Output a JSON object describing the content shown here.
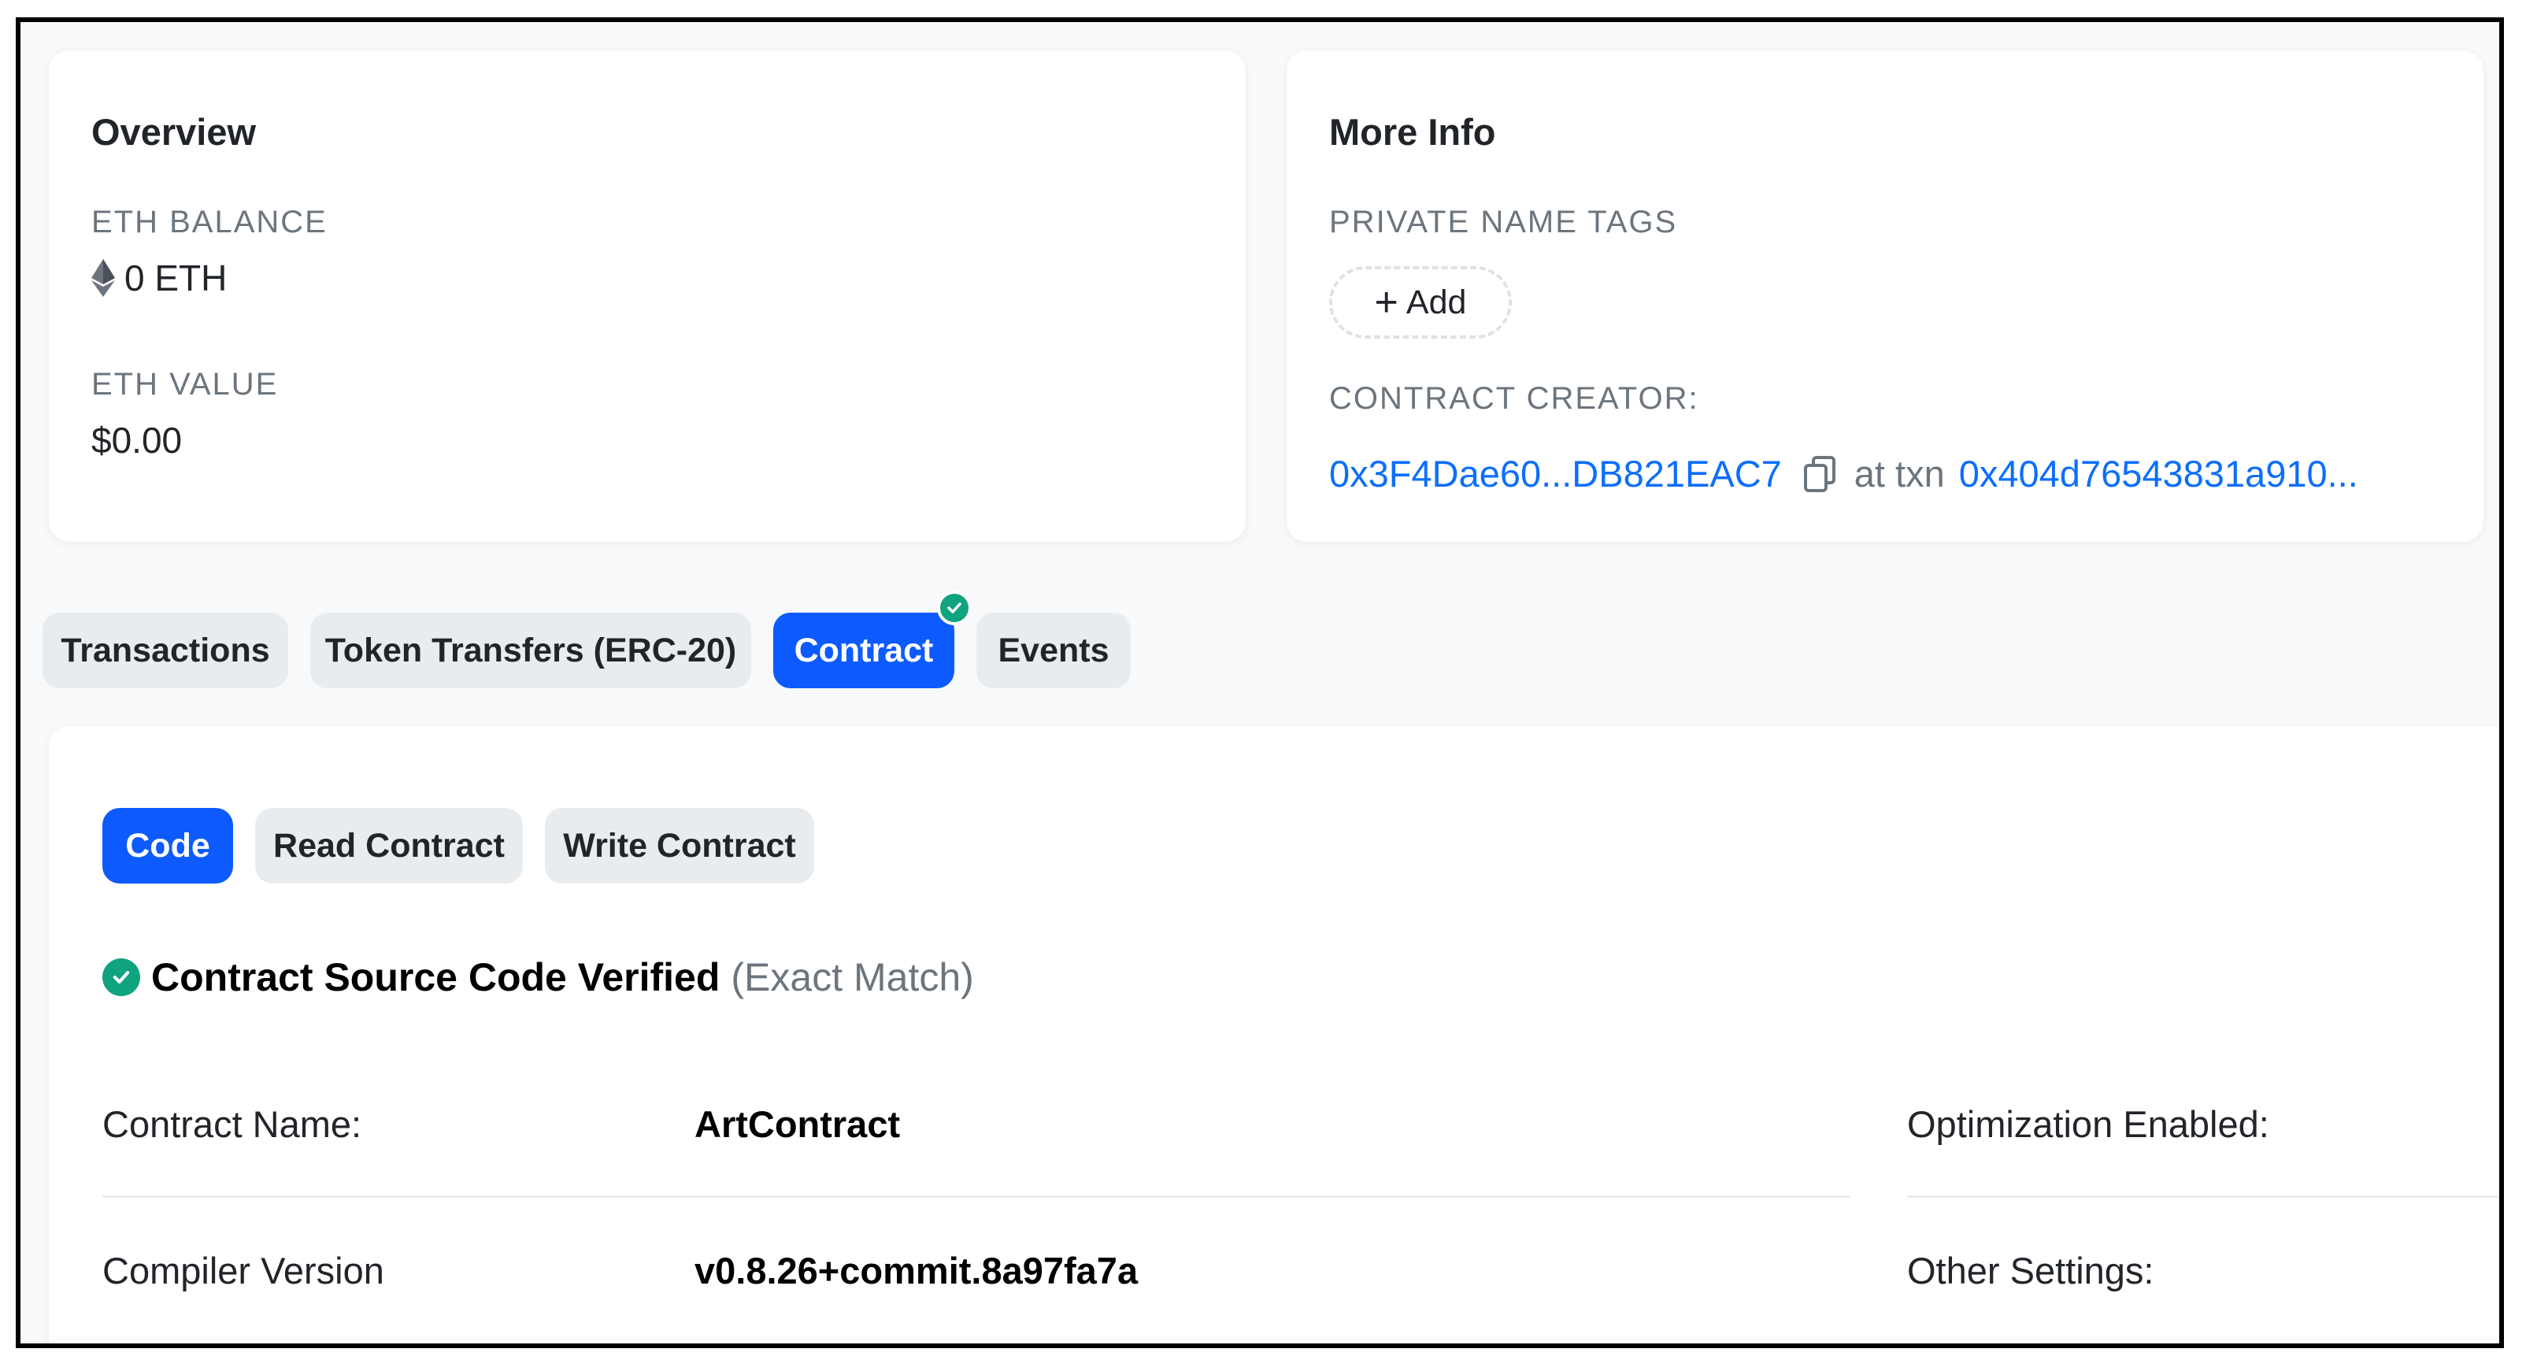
{
  "overview": {
    "title": "Overview",
    "eth_balance_label": "ETH BALANCE",
    "eth_balance_value": "0 ETH",
    "eth_value_label": "ETH VALUE",
    "eth_value_value": "$0.00"
  },
  "more_info": {
    "title": "More Info",
    "private_name_tags_label": "PRIVATE NAME TAGS",
    "add_label": "Add",
    "contract_creator_label": "CONTRACT CREATOR:",
    "creator_address": "0x3F4Dae60...DB821EAC7",
    "at_txn_text": "at txn",
    "txn_hash": "0x404d76543831a910..."
  },
  "tabs": [
    {
      "label": "Transactions",
      "active": false
    },
    {
      "label": "Token Transfers (ERC-20)",
      "active": false
    },
    {
      "label": "Contract",
      "active": true,
      "verified_badge": true
    },
    {
      "label": "Events",
      "active": false
    }
  ],
  "subtabs": [
    {
      "label": "Code",
      "active": true
    },
    {
      "label": "Read Contract",
      "active": false
    },
    {
      "label": "Write Contract",
      "active": false
    }
  ],
  "verification": {
    "title": "Contract Source Code Verified",
    "note": "(Exact Match)"
  },
  "contract_info": {
    "name_label": "Contract Name:",
    "name_value": "ArtContract",
    "compiler_label": "Compiler Version",
    "compiler_value": "v0.8.26+commit.8a97fa7a",
    "optimization_label": "Optimization Enabled:",
    "other_settings_label": "Other Settings:"
  },
  "colors": {
    "accent": "#0d5bff",
    "link": "#0d6efd",
    "verified_green": "#10a37f",
    "muted_text": "#6c757d"
  },
  "icons": [
    "ethereum-icon",
    "plus-icon",
    "copy-icon",
    "check-icon"
  ]
}
